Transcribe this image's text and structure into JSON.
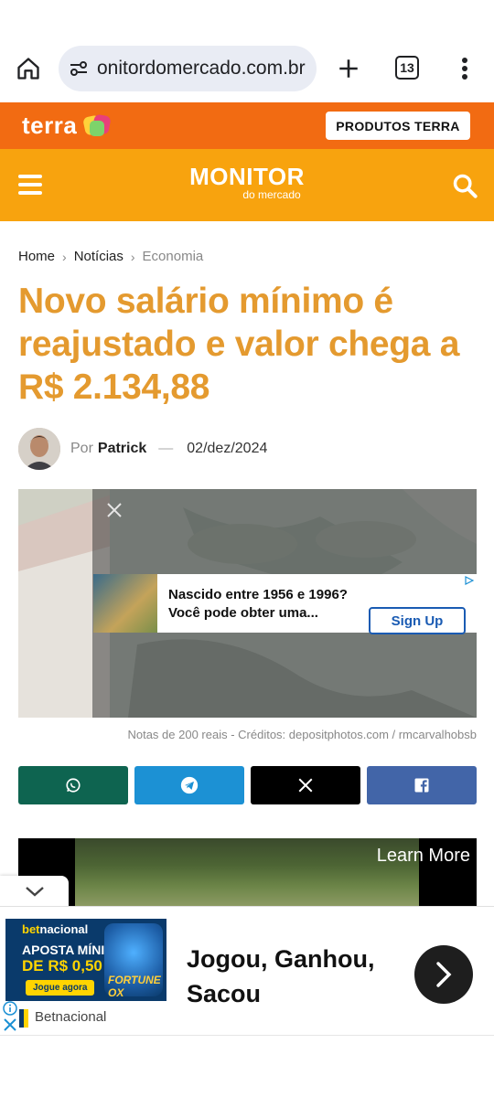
{
  "browser": {
    "url": "onitordomercado.com.br",
    "tab_count": "13"
  },
  "terra": {
    "logo_text": "terra",
    "products_button": "PRODUTOS TERRA"
  },
  "site": {
    "brand_line1": "MONITOR",
    "brand_line2": "do mercado"
  },
  "breadcrumb": {
    "items": [
      "Home",
      "Notícias",
      "Economia"
    ],
    "separator": "›"
  },
  "article": {
    "title": "Novo salário mínimo é reajustado e valor chega a R$ 2.134,88",
    "by_prefix": "Por",
    "author": "Patrick",
    "date_separator": "—",
    "date": "02/dez/2024",
    "caption": "Notas de 200 reais - Créditos: depositphotos.com / rmcarvalhobsb"
  },
  "inline_ad": {
    "text": "Nascido entre 1956 e 1996? Você pode obter uma...",
    "line1": "Nascido entre 1956 e 1996?",
    "line2": "Você pode obter uma...",
    "button": "Sign Up"
  },
  "video_ad": {
    "learn_more": "Learn More"
  },
  "bottom_ad": {
    "banner_logo_bet": "bet",
    "banner_logo_rest": "nacional",
    "banner_line1": "APOSTA MÍNIMA",
    "banner_line2": "DE R$ 0,50",
    "banner_cta": "Jogue agora",
    "banner_game": "FORTUNE OX",
    "headline_line1": "Jogou, Ganhou,",
    "headline_line2": "Sacou",
    "advertiser": "Betnacional"
  },
  "colors": {
    "terra_orange": "#f26b12",
    "header_orange": "#f8a30e",
    "title_gold": "#e49a2f",
    "whatsapp": "#0e6450",
    "telegram": "#1c91d4",
    "x": "#000000",
    "facebook": "#4265a8"
  }
}
